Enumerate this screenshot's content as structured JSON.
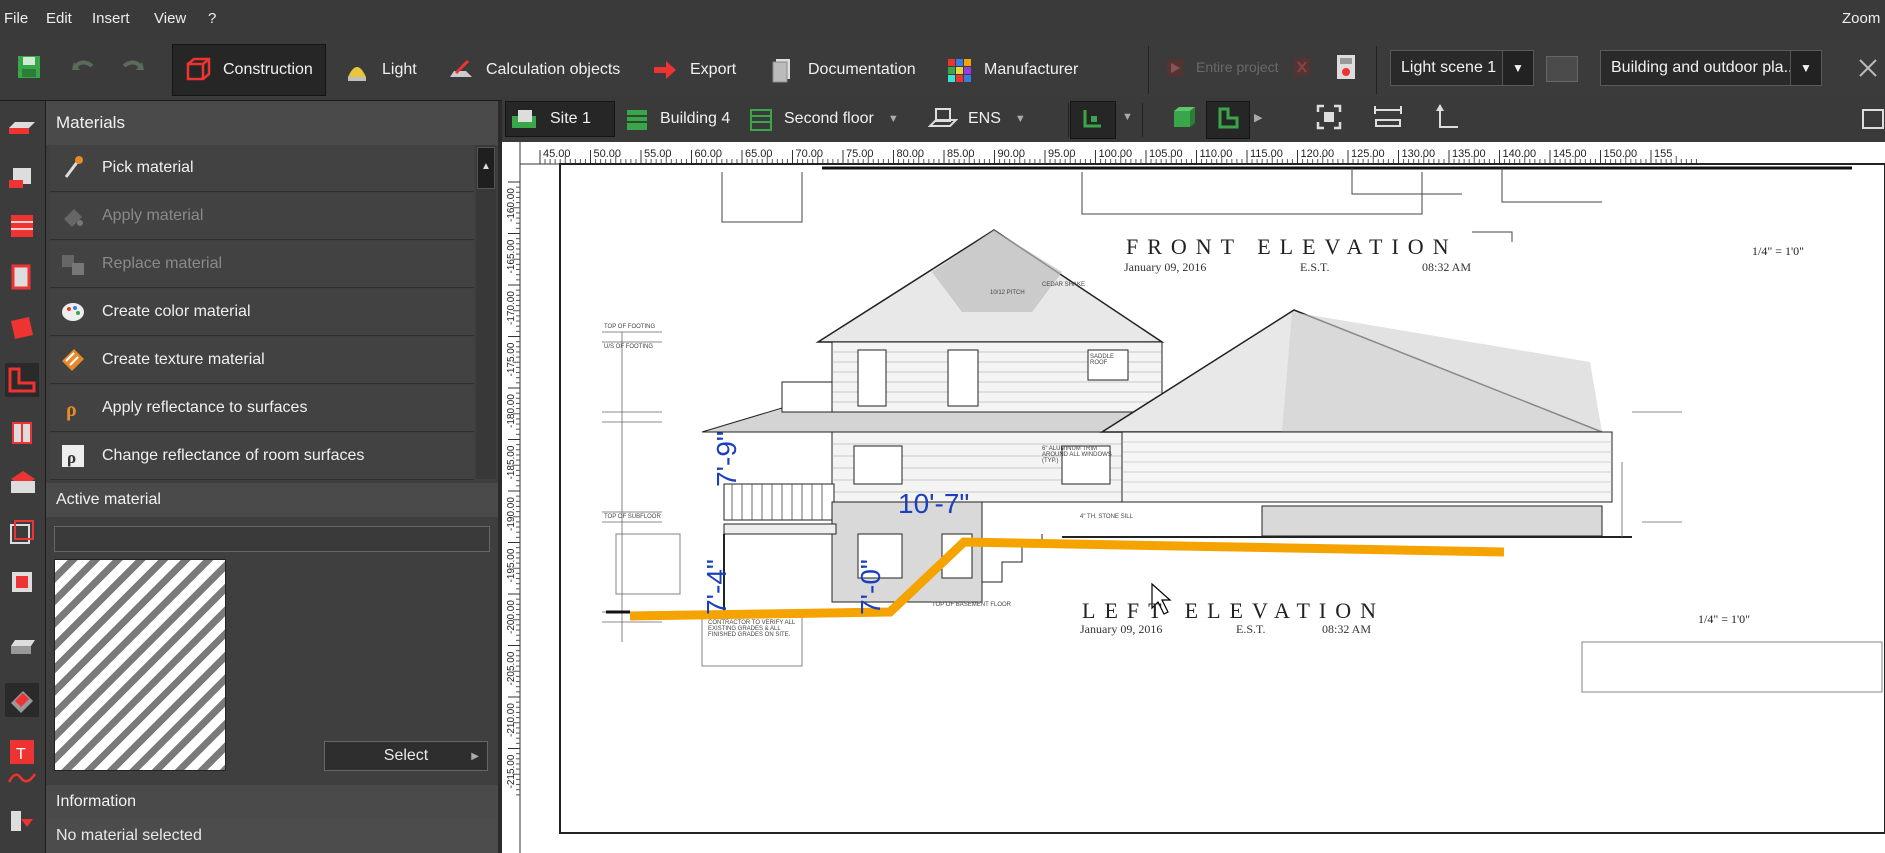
{
  "menubar": {
    "items": [
      "File",
      "Edit",
      "Insert",
      "View",
      "?"
    ],
    "right_label": "Zoom"
  },
  "toolbar": {
    "tabs": [
      {
        "label": "Construction",
        "icon": "cube-outline-icon",
        "active": true
      },
      {
        "label": "Light",
        "icon": "lamp-icon",
        "active": false
      },
      {
        "label": "Calculation objects",
        "icon": "calculation-plane-icon",
        "active": false
      },
      {
        "label": "Export",
        "icon": "export-arrow-icon",
        "active": false
      },
      {
        "label": "Documentation",
        "icon": "document-icon",
        "active": false
      },
      {
        "label": "Manufacturer",
        "icon": "manufacturer-grid-icon",
        "active": false
      }
    ],
    "entire_project_label": "Entire project",
    "light_scene": "Light scene 1",
    "scene_view": "Building and outdoor pla..."
  },
  "viewbar": {
    "site": "Site 1",
    "building": "Building 4",
    "floor": "Second floor",
    "view": "ENS"
  },
  "ruler": {
    "top_ticks": [
      "45.00",
      "50.00",
      "55.00",
      "60.00",
      "65.00",
      "70.00",
      "75.00",
      "80.00",
      "85.00",
      "90.00",
      "95.00",
      "100.00",
      "105.00",
      "110.00",
      "115.00",
      "120.00",
      "125.00",
      "130.00",
      "135.00",
      "140.00",
      "145.00",
      "150.00",
      "155"
    ],
    "left_ticks": [
      "-160.00",
      "-165.00",
      "-170.00",
      "-175.00",
      "-180.00",
      "-185.00",
      "-190.00",
      "-195.00",
      "-200.00",
      "-205.00",
      "-210.00",
      "-215.00"
    ]
  },
  "materials": {
    "title": "Materials",
    "items": [
      {
        "label": "Pick material",
        "icon": "eyedropper-icon",
        "enabled": true
      },
      {
        "label": "Apply material",
        "icon": "paint-bucket-icon",
        "enabled": false
      },
      {
        "label": "Replace material",
        "icon": "replace-icon",
        "enabled": false
      },
      {
        "label": "Create color material",
        "icon": "palette-icon",
        "enabled": true
      },
      {
        "label": "Create texture material",
        "icon": "texture-icon",
        "enabled": true
      },
      {
        "label": "Apply reflectance to surfaces",
        "icon": "reflectance-icon",
        "enabled": true
      },
      {
        "label": "Change reflectance of room surfaces",
        "icon": "room-reflectance-icon",
        "enabled": true
      }
    ]
  },
  "active_material": {
    "title": "Active material",
    "name_value": "",
    "select_label": "Select"
  },
  "information": {
    "title": "Information",
    "text": "No material selected"
  },
  "drawing": {
    "front_title": "FRONT ELEVATION",
    "front_scale": "1/4\" = 1'0\"",
    "front_date": "January 09, 2016",
    "front_tz": "E.S.T.",
    "front_time": "08:32 AM",
    "left_title": "LEFT ELEVATION",
    "left_scale": "1/4\" = 1'0\"",
    "left_date": "January 09, 2016",
    "left_tz": "E.S.T.",
    "left_time": "08:32 AM",
    "dim1": "7'-9\"",
    "dim2": "10'-7\"",
    "dim3": "7'-4\"",
    "dim4": "7'-0\"",
    "notes": [
      "CEDAR SHAKE",
      "10/12 PITCH",
      "SADDLE ROOF",
      "6\" ALUMINUM TRIM AROUND ALL WINDOWS (TYP.)",
      "4\" TH. STONE SILL",
      "TOP OF FOOTING",
      "U/S OF FOOTING",
      "TOP OF SUBFLOOR",
      "TOP OF BASEMENT FLOOR",
      "CONTRACTOR TO VERIFY ALL EXISTING GRADES & ALL FINISHED GRADES ON SITE."
    ]
  },
  "colors": {
    "accent_orange": "#f5a300",
    "dimension_blue": "#1b3fbf",
    "ui_dark": "#3b3b3b"
  }
}
